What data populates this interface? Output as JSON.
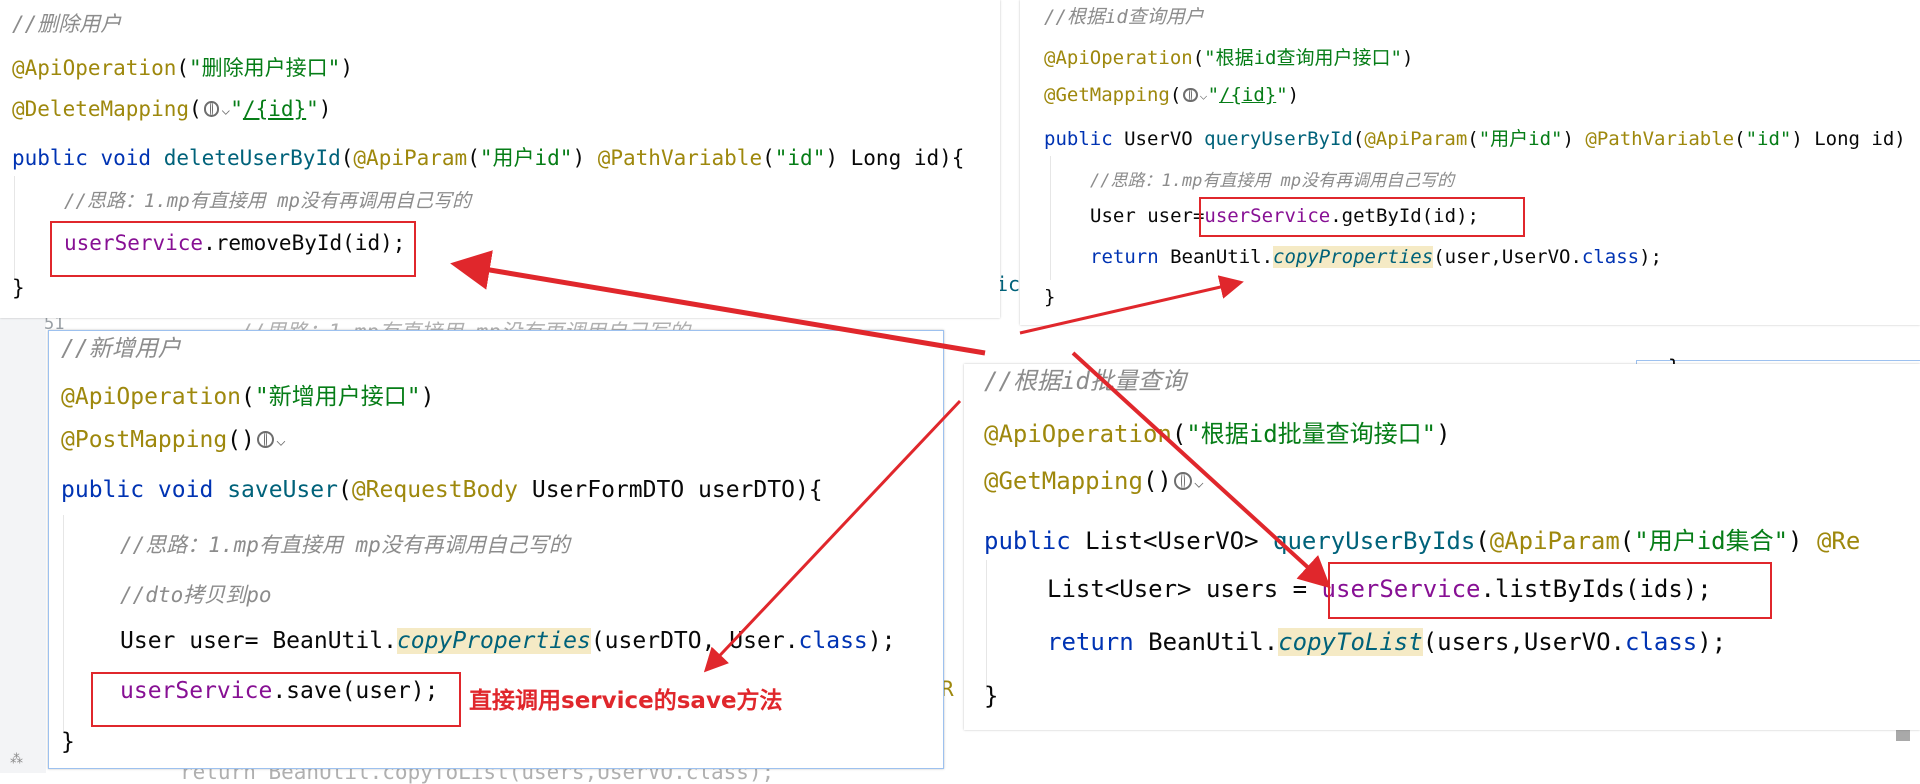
{
  "background": {
    "peek_comment": "//思路：1.mp有直接用 mp没有再调用自己写的",
    "peek_line_number": "51",
    "peek_r": "R",
    "peek_brace": "}",
    "peek_tolist": "return BeanUtil.copyToList(users,UserVO.class);",
    "peek_ic": "ic"
  },
  "panel_delete": {
    "comment": "//删除用户",
    "api_annotation": "@ApiOperation",
    "api_text": "\"删除用户接口\"",
    "mapping": "@DeleteMapping",
    "path": "/{id}",
    "sig_kw": "public void",
    "sig_fn": "deleteUserById",
    "sig_param_ann": "@ApiParam",
    "sig_param_str": "\"用户id\"",
    "sig_pv_ann": "@PathVariable",
    "sig_pv_str": "\"id\"",
    "sig_tail": " Long id){",
    "idea": "//思路：1.mp有直接用 mp没有再调用自己写的",
    "call_obj": "userService",
    "call_rest": ".removeById(id);",
    "close": "}"
  },
  "panel_get": {
    "comment": "//根据id查询用户",
    "api_annotation": "@ApiOperation",
    "api_text": "\"根据id查询用户接口\"",
    "mapping": "@GetMapping",
    "path": "/{id}",
    "sig_kw": "public",
    "sig_type": " UserVO ",
    "sig_fn": "queryUserById",
    "sig_param_ann": "@ApiParam",
    "sig_param_str": "\"用户id\"",
    "sig_pv_ann": "@PathVariable",
    "sig_pv_str": "\"id\"",
    "sig_tail": " Long id)",
    "idea": "//思路：1.mp有直接用 mp没有再调用自己写的",
    "decl": "User user=",
    "call_obj": "userService",
    "call_rest": ".getById(id);",
    "ret_kw": "return",
    "ret_util": " BeanUtil.",
    "ret_fn": "copyProperties",
    "ret_args": "(user,UserVO.",
    "ret_class": "class",
    "ret_end": ");",
    "close": "}"
  },
  "panel_save": {
    "comment": "//新增用户",
    "api_annotation": "@ApiOperation",
    "api_text": "\"新增用户接口\"",
    "mapping": "@PostMapping",
    "sig_kw": "public void",
    "sig_fn": "saveUser",
    "sig_body_ann": "@RequestBody",
    "sig_tail": " UserFormDTO userDTO){",
    "idea": "//思路：1.mp有直接用 mp没有再调用自己写的",
    "dto_comment": "//dto拷贝到po",
    "decl": "User user= BeanUtil.",
    "copy_fn": "copyProperties",
    "copy_args": "(userDTO, User.",
    "copy_class": "class",
    "copy_end": ");",
    "call_obj": "userService",
    "call_rest": ".save(user);",
    "close": "}",
    "callout": "直接调用service的save方法"
  },
  "panel_batch": {
    "comment": "//根据id批量查询",
    "api_annotation": "@ApiOperation",
    "api_text": "\"根据id批量查询接口\"",
    "mapping": "@GetMapping",
    "sig_kw": "public",
    "sig_type": " List<UserVO> ",
    "sig_fn": "queryUserByIds",
    "sig_param_ann": "@ApiParam",
    "sig_param_str": "\"用户id集合\"",
    "sig_tail_ann": "@Re",
    "decl": "List<User> users = ",
    "call_obj": "userService",
    "call_rest": ".listByIds(ids);",
    "ret_kw": "return",
    "ret_util": " BeanUtil.",
    "ret_fn": "copyToList",
    "ret_args": "(users,UserVO.",
    "ret_class": "class",
    "ret_end": ");",
    "close": "}"
  },
  "colors": {
    "highlight_red": "#e0272c",
    "annotation": "#9e880d",
    "string": "#067d17",
    "keyword": "#0033b3",
    "method": "#00627a",
    "field": "#871094",
    "comment": "#8c8c8c"
  }
}
